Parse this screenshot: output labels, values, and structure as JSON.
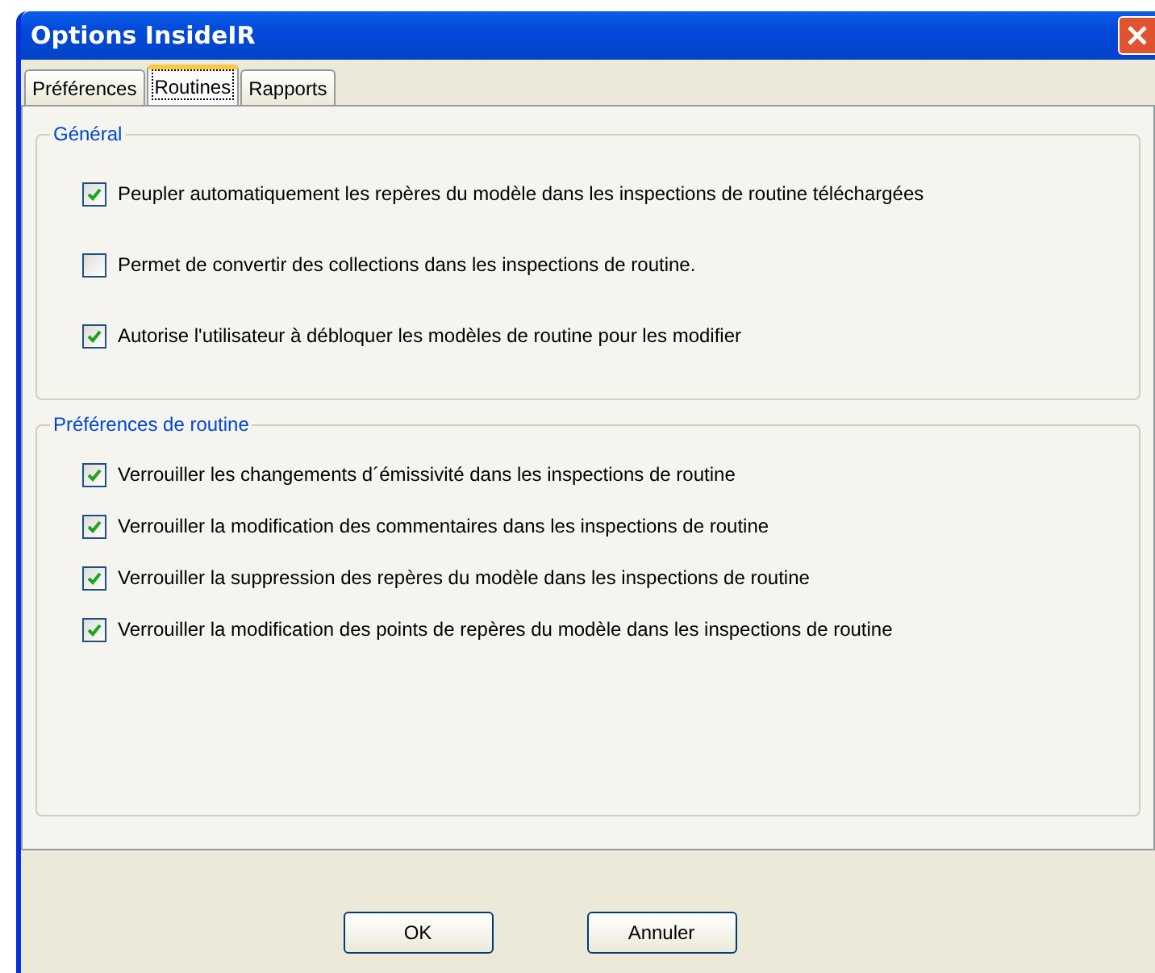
{
  "window": {
    "title": "Options InsideIR"
  },
  "tabs": [
    {
      "label": "Préférences",
      "selected": false
    },
    {
      "label": "Routines",
      "selected": true
    },
    {
      "label": "Rapports",
      "selected": false
    }
  ],
  "groups": [
    {
      "title": "Général",
      "options": [
        {
          "label": "Peupler automatiquement les repères du modèle dans les inspections de routine téléchargées",
          "checked": true
        },
        {
          "label": "Permet de convertir des collections dans les inspections de routine.",
          "checked": false
        },
        {
          "label": "Autorise l'utilisateur à débloquer les modèles de routine pour les modifier",
          "checked": true
        }
      ]
    },
    {
      "title": "Préférences de routine",
      "options": [
        {
          "label": "Verrouiller les changements d´émissivité dans les inspections de routine",
          "checked": true
        },
        {
          "label": "Verrouiller la modification des commentaires dans les inspections de routine",
          "checked": true
        },
        {
          "label": "Verrouiller la suppression des repères du modèle dans les inspections de routine",
          "checked": true
        },
        {
          "label": "Verrouiller la modification des points de repères du modèle dans les inspections de routine",
          "checked": true
        }
      ]
    }
  ],
  "buttons": [
    "OK",
    "Annuler"
  ]
}
